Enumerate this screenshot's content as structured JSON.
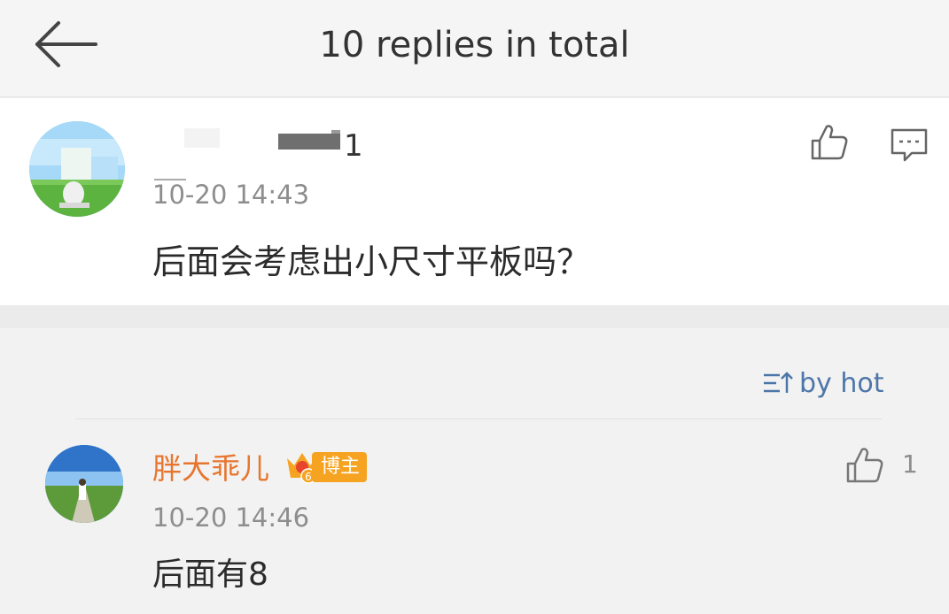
{
  "header": {
    "title": "10 replies in total",
    "back_icon": "arrow-left-icon"
  },
  "main_comment": {
    "username_visible_suffix": "1",
    "timestamp": "10-20 14:43",
    "content": "后面会考虑出小尺寸平板吗？",
    "like_icon": "thumbs-up-icon",
    "reply_icon": "comment-icon"
  },
  "sort": {
    "label": "by hot",
    "icon": "sort-icon",
    "color": "#4d76a8"
  },
  "replies": [
    {
      "username": "胖大乖儿",
      "badge_label": "博主",
      "badge_level": "6",
      "timestamp": "10-20 14:46",
      "content": "后面有8",
      "like_count": "1"
    }
  ],
  "colors": {
    "accent_orange": "#e8752f",
    "badge_orange": "#f5a321",
    "muted_text": "#8d8d8d"
  }
}
